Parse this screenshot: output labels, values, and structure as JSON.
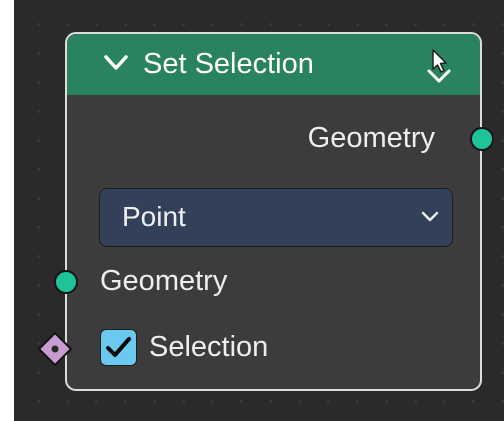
{
  "node": {
    "title": "Set Selection",
    "header_color": "#2a8360",
    "icons": {
      "collapse": "chevron-down-icon",
      "status": "cursor-arrow-icon"
    },
    "output": {
      "label": "Geometry",
      "socket_color": "#1fc39a"
    },
    "domain_dropdown": {
      "value": "Point"
    },
    "inputs": {
      "geometry": {
        "label": "Geometry",
        "socket_color": "#1fc39a"
      },
      "selection": {
        "label": "Selection",
        "checked": true,
        "socket_color": "#c79cd0",
        "checkbox_color": "#6bc8ee"
      }
    }
  }
}
